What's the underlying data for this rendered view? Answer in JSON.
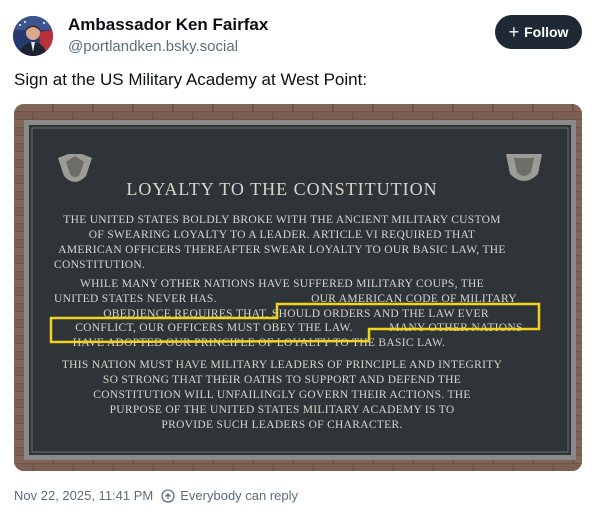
{
  "author": {
    "name": "Ambassador Ken Fairfax",
    "handle": "@portlandken.bsky.social"
  },
  "follow_label": "Follow",
  "post": {
    "text": "Sign at the US Military Academy at West Point:",
    "timestamp": "Nov 22, 2025, 11:41 PM",
    "reply_setting": "Everybody can reply"
  },
  "plaque": {
    "title": "LOYALTY TO THE CONSTITUTION",
    "lines": [
      "THE UNITED STATES BOLDLY BROKE WITH THE ANCIENT MILITARY CUSTOM",
      "OF SWEARING LOYALTY TO A LEADER.  ARTICLE VI REQUIRED THAT",
      "AMERICAN OFFICERS THEREAFTER SWEAR LOYALTY TO OUR BASIC LAW, THE",
      "CONSTITUTION.",
      "WHILE MANY OTHER NATIONS HAVE SUFFERED MILITARY COUPS, THE",
      "UNITED STATES NEVER HAS.",
      "OUR AMERICAN CODE OF MILITARY",
      "OBEDIENCE REQUIRES THAT, SHOULD ORDERS AND THE LAW EVER",
      "CONFLICT, OUR OFFICERS MUST OBEY THE LAW.",
      "MANY OTHER NATIONS",
      "HAVE ADOPTED OUR PRINCIPLE OF LOYALTY TO THE BASIC LAW.",
      "THIS NATION MUST HAVE MILITARY LEADERS OF PRINCIPLE AND INTEGRITY",
      "SO STRONG THAT THEIR OATHS TO SUPPORT AND DEFEND THE",
      "CONSTITUTION WILL UNFAILINGLY GOVERN THEIR ACTIONS.  THE",
      "PURPOSE OF THE UNITED STATES MILITARY ACADEMY IS TO",
      "PROVIDE SUCH LEADERS OF CHARACTER."
    ]
  },
  "colors": {
    "follow_bg": "#1f2935",
    "highlight": "#f2d21c",
    "plaque_bg": "#2e3438",
    "brick": "#7a5e50",
    "muted_text": "#5e6c7c"
  },
  "icons": [
    "plus-icon",
    "reply-settings-icon",
    "crest-icon"
  ]
}
